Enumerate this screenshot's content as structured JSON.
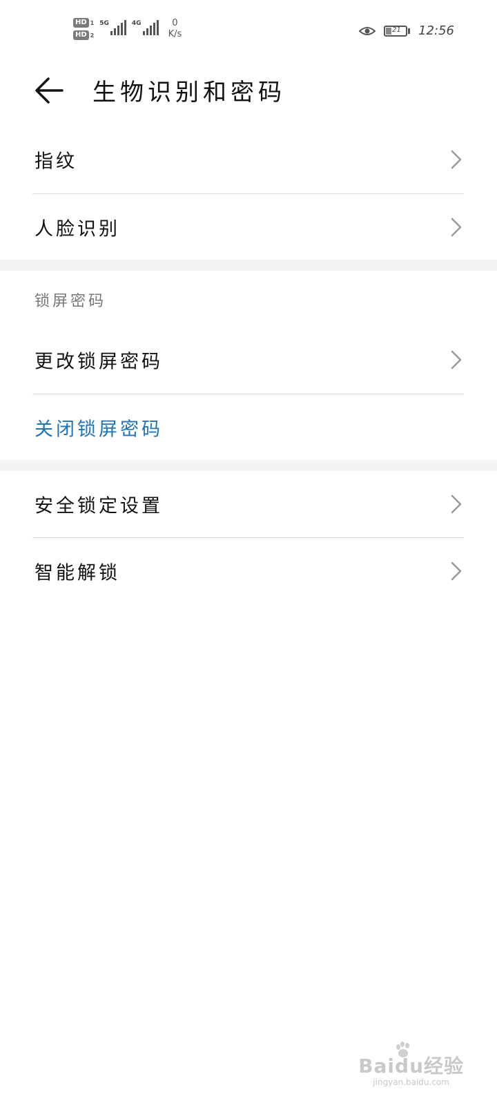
{
  "status_bar": {
    "sim1": "HD",
    "sim1_index": "1",
    "sim2": "HD",
    "sim2_index": "2",
    "network1": "5G",
    "network2": "4G",
    "speed_value": "0",
    "speed_unit": "K/s",
    "battery": "21",
    "time": "12:56"
  },
  "header": {
    "title": "生物识别和密码"
  },
  "biometrics": {
    "fingerprint": "指纹",
    "face": "人脸识别"
  },
  "lock_screen": {
    "section_title": "锁屏密码",
    "change": "更改锁屏密码",
    "disable": "关闭锁屏密码"
  },
  "security": {
    "lock_settings": "安全锁定设置",
    "smart_unlock": "智能解锁"
  },
  "watermark": {
    "brand": "Baidu经验",
    "url": "jingyan.baidu.com"
  },
  "colors": {
    "accent": "#1f73b7",
    "divider": "#dadada",
    "band": "#f3f3f5"
  }
}
